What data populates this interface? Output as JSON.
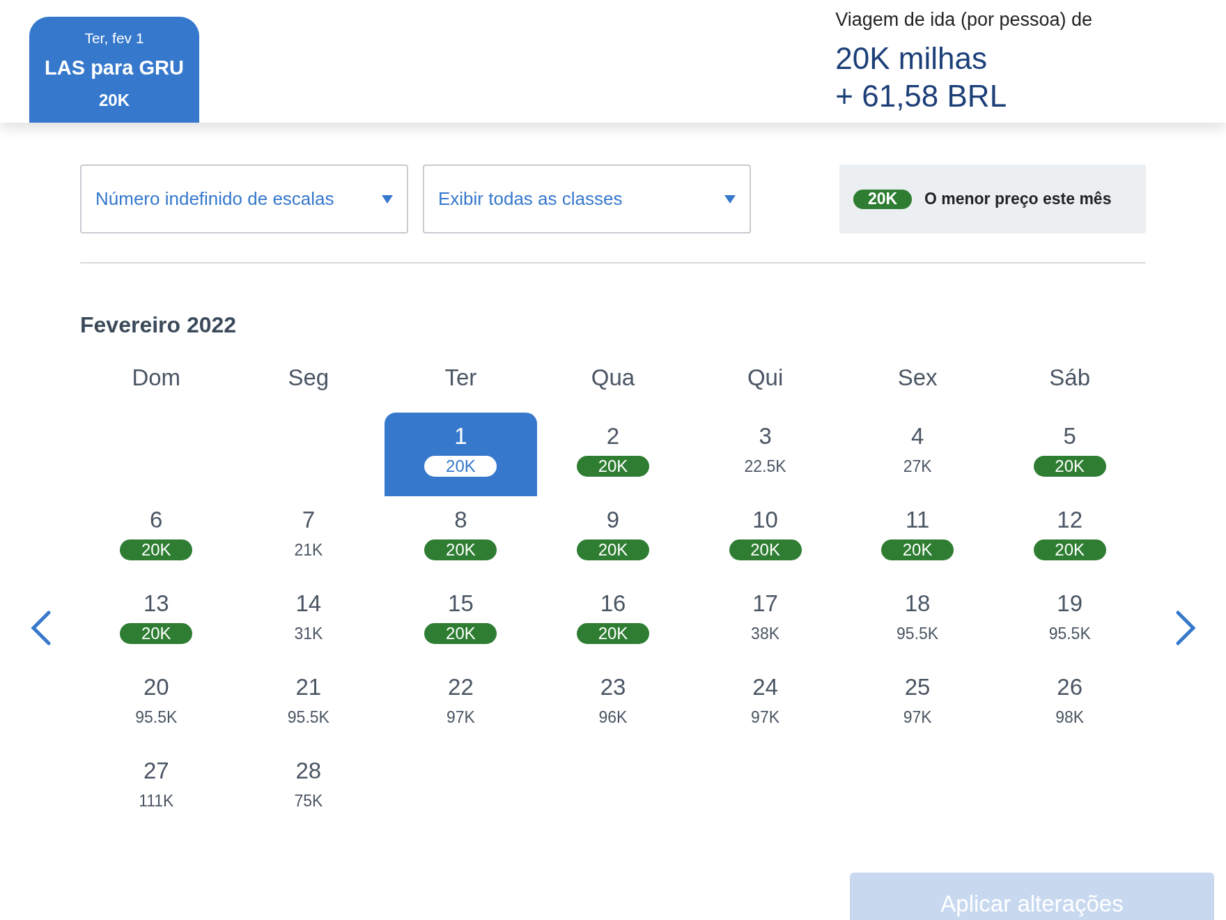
{
  "trip_tab": {
    "date": "Ter, fev 1",
    "route": "LAS para GRU",
    "price": "20K",
    "selected": true
  },
  "summary": {
    "label": "Viagem de ida (por pessoa) de",
    "miles": "20K milhas",
    "fee": "+ 61,58 BRL"
  },
  "filters": [
    {
      "value": "Número indefinido de escalas"
    },
    {
      "value": "Exibir todas as classes"
    }
  ],
  "legend": {
    "tag": "20K",
    "text": "O menor preço este mês"
  },
  "calendar": {
    "month": "Fevereiro 2022",
    "weekdays": [
      "Dom",
      "Seg",
      "Ter",
      "Qua",
      "Qui",
      "Sex",
      "Sáb"
    ],
    "weeks": [
      [
        {
          "kind": "blank"
        },
        {
          "kind": "blank"
        },
        {
          "kind": "day",
          "day": "1",
          "price": "20K",
          "lowest": true,
          "selected": true
        },
        {
          "kind": "day",
          "day": "2",
          "price": "20K",
          "lowest": true,
          "selected": false
        },
        {
          "kind": "day",
          "day": "3",
          "price": "22.5K",
          "lowest": false,
          "selected": false
        },
        {
          "kind": "day",
          "day": "4",
          "price": "27K",
          "lowest": false,
          "selected": false
        },
        {
          "kind": "day",
          "day": "5",
          "price": "20K",
          "lowest": true,
          "selected": false
        }
      ],
      [
        {
          "kind": "day",
          "day": "6",
          "price": "20K",
          "lowest": true,
          "selected": false
        },
        {
          "kind": "day",
          "day": "7",
          "price": "21K",
          "lowest": false,
          "selected": false
        },
        {
          "kind": "day",
          "day": "8",
          "price": "20K",
          "lowest": true,
          "selected": false
        },
        {
          "kind": "day",
          "day": "9",
          "price": "20K",
          "lowest": true,
          "selected": false
        },
        {
          "kind": "day",
          "day": "10",
          "price": "20K",
          "lowest": true,
          "selected": false
        },
        {
          "kind": "day",
          "day": "11",
          "price": "20K",
          "lowest": true,
          "selected": false
        },
        {
          "kind": "day",
          "day": "12",
          "price": "20K",
          "lowest": true,
          "selected": false
        }
      ],
      [
        {
          "kind": "day",
          "day": "13",
          "price": "20K",
          "lowest": true,
          "selected": false
        },
        {
          "kind": "day",
          "day": "14",
          "price": "31K",
          "lowest": false,
          "selected": false
        },
        {
          "kind": "day",
          "day": "15",
          "price": "20K",
          "lowest": true,
          "selected": false
        },
        {
          "kind": "day",
          "day": "16",
          "price": "20K",
          "lowest": true,
          "selected": false
        },
        {
          "kind": "day",
          "day": "17",
          "price": "38K",
          "lowest": false,
          "selected": false
        },
        {
          "kind": "day",
          "day": "18",
          "price": "95.5K",
          "lowest": false,
          "selected": false
        },
        {
          "kind": "day",
          "day": "19",
          "price": "95.5K",
          "lowest": false,
          "selected": false
        }
      ],
      [
        {
          "kind": "day",
          "day": "20",
          "price": "95.5K",
          "lowest": false,
          "selected": false
        },
        {
          "kind": "day",
          "day": "21",
          "price": "95.5K",
          "lowest": false,
          "selected": false
        },
        {
          "kind": "day",
          "day": "22",
          "price": "97K",
          "lowest": false,
          "selected": false
        },
        {
          "kind": "day",
          "day": "23",
          "price": "96K",
          "lowest": false,
          "selected": false
        },
        {
          "kind": "day",
          "day": "24",
          "price": "97K",
          "lowest": false,
          "selected": false
        },
        {
          "kind": "day",
          "day": "25",
          "price": "97K",
          "lowest": false,
          "selected": false
        },
        {
          "kind": "day",
          "day": "26",
          "price": "98K",
          "lowest": false,
          "selected": false
        }
      ],
      [
        {
          "kind": "day",
          "day": "27",
          "price": "111K",
          "lowest": false,
          "selected": false
        },
        {
          "kind": "day",
          "day": "28",
          "price": "75K",
          "lowest": false,
          "selected": false
        },
        {
          "kind": "blank"
        },
        {
          "kind": "blank"
        },
        {
          "kind": "blank"
        },
        {
          "kind": "blank"
        },
        {
          "kind": "blank"
        }
      ]
    ]
  },
  "apply_button": {
    "label": "Aplicar alterações",
    "disabled": true
  }
}
